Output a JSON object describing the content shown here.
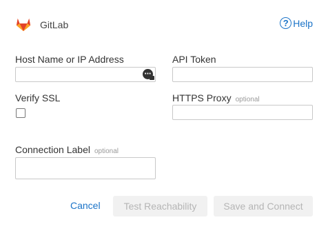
{
  "header": {
    "app_name": "GitLab",
    "help_label": "Help",
    "help_icon": "?",
    "logo_icon": "gitlab-fox-logo"
  },
  "form": {
    "host": {
      "label": "Host Name or IP Address",
      "value": "",
      "placeholder": ""
    },
    "api_token": {
      "label": "API Token",
      "value": "",
      "placeholder": ""
    },
    "verify_ssl": {
      "label": "Verify SSL",
      "checked": false
    },
    "https_proxy": {
      "label": "HTTPS Proxy",
      "optional": "optional",
      "value": ""
    },
    "connection_label": {
      "label": "Connection Label",
      "optional": "optional",
      "value": ""
    }
  },
  "actions": {
    "cancel_label": "Cancel",
    "test_label": "Test Reachability",
    "save_label": "Save and Connect"
  },
  "colors": {
    "accent": "#1a73c8",
    "logo_orange": "#e24329",
    "disabled_text": "#b5b5b5",
    "disabled_bg": "#f1f1f1"
  }
}
